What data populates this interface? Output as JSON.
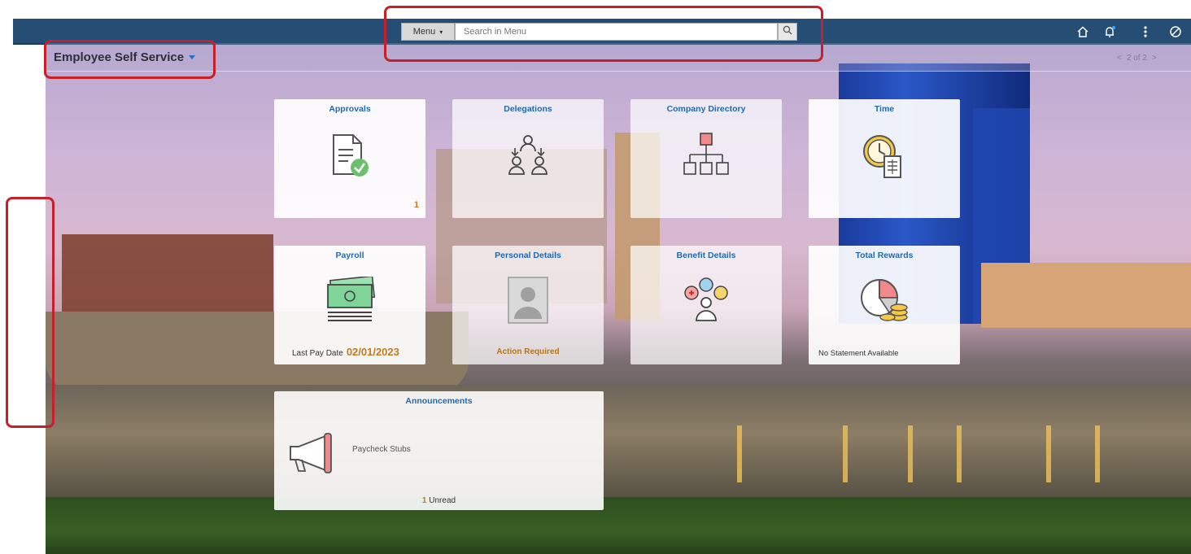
{
  "topbar": {
    "menu_label": "Menu",
    "search_placeholder": "Search in Menu",
    "icons": [
      "home-icon",
      "bell-icon",
      "more-options-icon",
      "navbar-icon"
    ]
  },
  "header": {
    "title": "Employee Self Service",
    "pager": {
      "prev": "<",
      "label": "2 of 2",
      "next": ">"
    }
  },
  "rail": {
    "icons": [
      "recent-clock-icon",
      "favorites-heart-icon"
    ]
  },
  "tiles": {
    "approvals": {
      "title": "Approvals",
      "count": "1"
    },
    "delegations": {
      "title": "Delegations"
    },
    "company_directory": {
      "title": "Company Directory"
    },
    "time": {
      "title": "Time"
    },
    "payroll": {
      "title": "Payroll",
      "label": "Last Pay Date",
      "date": "02/01/2023"
    },
    "personal_details": {
      "title": "Personal Details",
      "status": "Action Required"
    },
    "benefit_details": {
      "title": "Benefit Details"
    },
    "total_rewards": {
      "title": "Total Rewards",
      "status": "No Statement Available"
    },
    "announcements": {
      "title": "Announcements",
      "item": "Paycheck Stubs",
      "unread_count": "1",
      "unread_label": "Unread"
    }
  },
  "colors": {
    "topbar": "#264e75",
    "tile_title": "#2169b3",
    "accent_orange": "#c27a1e",
    "highlight_red": "#c8202a"
  }
}
